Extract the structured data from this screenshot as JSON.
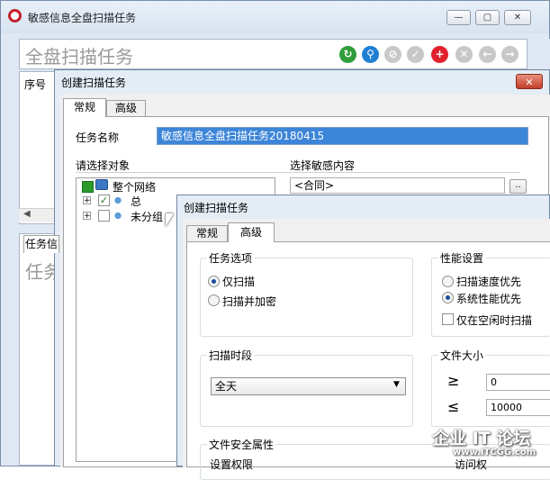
{
  "main_window": {
    "title": "敏感信息全盘扫描任务",
    "heading": "全盘扫描任务",
    "list_header_col1": "序号",
    "bottom_tab": "任务信",
    "bottom_heading": "任务",
    "toolbar_icons": [
      "refresh-icon",
      "search-icon",
      "disable-icon",
      "check-icon",
      "add-icon",
      "delete-icon",
      "back-icon",
      "forward-icon"
    ],
    "minimize_glyph": "—",
    "maximize_glyph": "▢",
    "close_glyph": "✕"
  },
  "dialog1": {
    "title": "创建扫描任务",
    "close_glyph": "✕",
    "tabs": [
      "常规",
      "高级"
    ],
    "task_name_label": "任务名称",
    "task_name_value": "敏感信息全盘扫描任务20180415",
    "select_object_label": "请选择对象",
    "select_content_label": "选择敏感内容",
    "content_value": "<合同>",
    "browse_label": "..",
    "tree": {
      "root": "整个网络",
      "child1": "总",
      "child2": "未分组"
    },
    "expand_glyph": "+"
  },
  "dialog2": {
    "title": "创建扫描任务",
    "tabs": [
      "常规",
      "高级"
    ],
    "task_options": {
      "title": "任务选项",
      "opt1": "仅扫描",
      "opt2": "扫描并加密"
    },
    "performance": {
      "title": "性能设置",
      "opt1": "扫描速度优先",
      "opt2": "系统性能优先",
      "idle_scan": "仅在空闲时扫描"
    },
    "scan_period": {
      "title": "扫描时段",
      "value": "全天"
    },
    "file_size": {
      "title": "文件大小",
      "ge_symbol": "≥",
      "le_symbol": "≤",
      "min": "0",
      "max": "10000"
    },
    "file_security": {
      "title": "文件安全属性",
      "set_permission": "设置权限",
      "right_label": "访问权"
    }
  },
  "watermark": {
    "line1": "企业 IT 论坛",
    "line2": "www.ITCGG.com"
  }
}
